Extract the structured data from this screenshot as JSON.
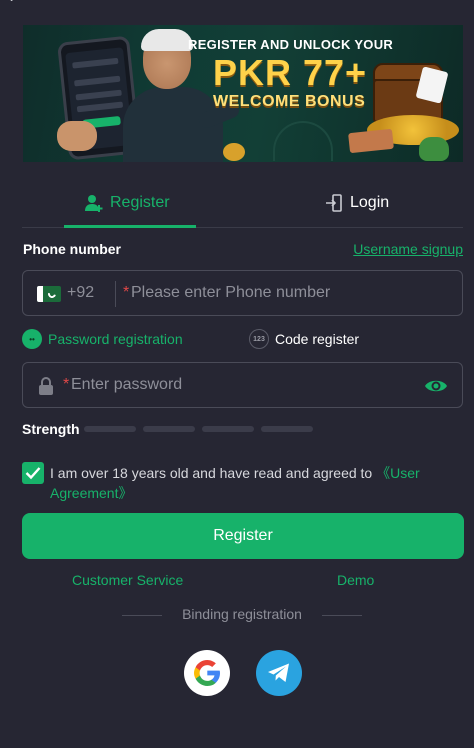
{
  "nav": {
    "back_icon": "chevron-left-icon"
  },
  "banner": {
    "title": "REGISTER AND UNLOCK YOUR",
    "amount": "PKR 77+",
    "subtitle": "WELCOME BONUS",
    "colors": {
      "accent": "#ffd24a"
    }
  },
  "tabs": {
    "register_label": "Register",
    "login_label": "Login",
    "active": "register"
  },
  "phone": {
    "label": "Phone number",
    "alt_signup_link": "Username signup",
    "country_code": "+92",
    "flag": "pakistan-flag",
    "required_mark": "*",
    "placeholder": "Please enter Phone number"
  },
  "registration_options": {
    "password_label": "Password registration",
    "code_label": "Code register",
    "code_badge": "123",
    "selected": "password"
  },
  "password": {
    "required_mark": "*",
    "placeholder": "Enter password",
    "strength_label": "Strength"
  },
  "agreement": {
    "checked": true,
    "text": "I am over 18 years old and have read and agreed to ",
    "link_text": "《User Agreement》"
  },
  "actions": {
    "register_button": "Register",
    "customer_service": "Customer Service",
    "demo": "Demo",
    "binding_text": "Binding registration"
  },
  "social": [
    "google-icon",
    "telegram-icon"
  ],
  "colors": {
    "background": "#262633",
    "accent": "#17b26a",
    "border": "#4a4b58",
    "muted": "#8e8f99"
  }
}
